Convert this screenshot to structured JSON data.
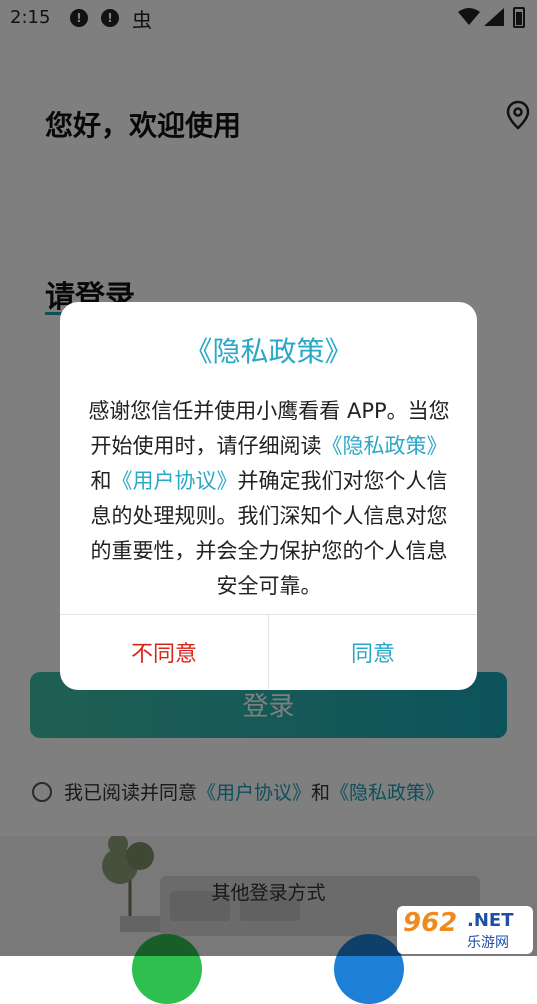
{
  "status_bar": {
    "time": "2:15",
    "bug_glyph": "虫"
  },
  "login": {
    "greeting": "您好，欢迎使用",
    "title": "请登录",
    "login_button": "登录",
    "agreement_prefix": "我已阅读并同意",
    "agreement_user": "《用户协议》",
    "agreement_and": "和",
    "agreement_privacy": "《隐私政策》",
    "other_login": "其他登录方式"
  },
  "dialog": {
    "title": "《隐私政策》",
    "body_1": "感谢您信任并使用小鹰看看 APP。当您开始使用时，请仔细阅读",
    "link_privacy": "《隐私政策》",
    "body_2": "和",
    "link_user": "《用户协议》",
    "body_3": "并确定我们对您个人信息的处理规则。我们深知个人信息对您的重要性，并会全力保护您的个人信息安全可靠。",
    "disagree": "不同意",
    "agree": "同意"
  },
  "watermark": {
    "num": "962",
    "net": ".NET",
    "cn": "乐游网"
  },
  "colors": {
    "accent": "#2aa8c8",
    "danger": "#d9261c",
    "overlay": "rgba(0,0,0,0.5)"
  }
}
